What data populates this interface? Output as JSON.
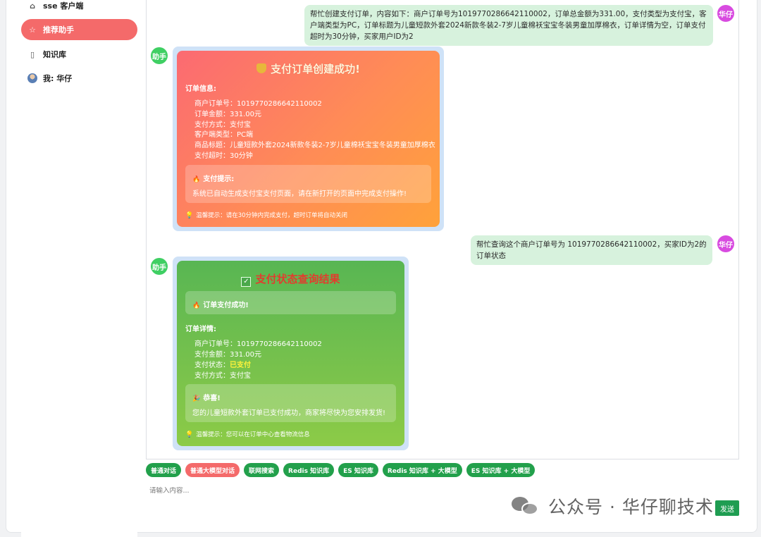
{
  "sidebar": {
    "items": [
      {
        "label": "sse 客户端",
        "icon": "home-icon"
      },
      {
        "label": "推荐助手",
        "icon": "star-icon"
      },
      {
        "label": "知识库",
        "icon": "book-icon"
      },
      {
        "label": "我: 华仔",
        "icon": "avatar"
      }
    ]
  },
  "chat": {
    "user_name": "华仔",
    "bot_name": "助手",
    "messages": {
      "m1": "帮忙创建支付订单，内容如下：商户订单号为1019770286642110002，订单总金额为331.00，支付类型为支付宝，客户端类型为PC，订单标题为儿童短款外套2024新款冬装2-7岁儿童棉袄宝宝冬装男童加厚棉衣，订单详情为空，订单支付超时为30分钟，买家用户ID为2",
      "m3": "帮忙查询这个商户订单号为 1019770286642110002，买家ID为2的订单状态"
    },
    "order_card": {
      "title": "支付订单创建成功!",
      "info_label": "订单信息:",
      "lines": [
        "商户订单号：1019770286642110002",
        "订单金额：331.00元",
        "支付方式：支付宝",
        "客户端类型：PC端",
        "商品标题：儿童短款外套2024新款冬装2-7岁儿童棉袄宝宝冬装男童加厚棉衣",
        "支付超时：30分钟"
      ],
      "notice_title": "支付提示:",
      "notice_body": "系统已自动生成支付宝支付页面，请在新打开的页面中完成支付操作!",
      "tip": "温馨提示：请在30分钟内完成支付，超时订单将自动关闭"
    },
    "status_card": {
      "title": "支付状态查询结果",
      "success_label": "订单支付成功!",
      "detail_label": "订单详情:",
      "line1": "商户订单号：1019770286642110002",
      "line2": "支付金额：331.00元",
      "line3_prefix": "支付状态：",
      "line3_value": "已支付",
      "line4": "支付方式：支付宝",
      "congrats_title": "恭喜!",
      "congrats_body": "您的儿童短款外套订单已支付成功，商家将尽快为您安排发货!",
      "tip": "温馨提示：您可以在订单中心查看物流信息"
    }
  },
  "modes": [
    "普通对话",
    "普通大模型对话",
    "联网搜索",
    "Redis 知识库",
    "ES 知识库",
    "Redis 知识库 + 大模型",
    "ES 知识库 + 大模型"
  ],
  "active_mode": "普通大模型对话",
  "input": {
    "placeholder": "请输入内容..."
  },
  "send_label": "发送",
  "watermark": {
    "text": "公众号 · 华仔聊技术"
  },
  "colors": {
    "accent": "#f46a6a",
    "mode_green": "#22a04b",
    "user_bubble": "#d7f2dd",
    "user_avatar": "#d84be0",
    "bot_avatar": "#3fcf63"
  }
}
